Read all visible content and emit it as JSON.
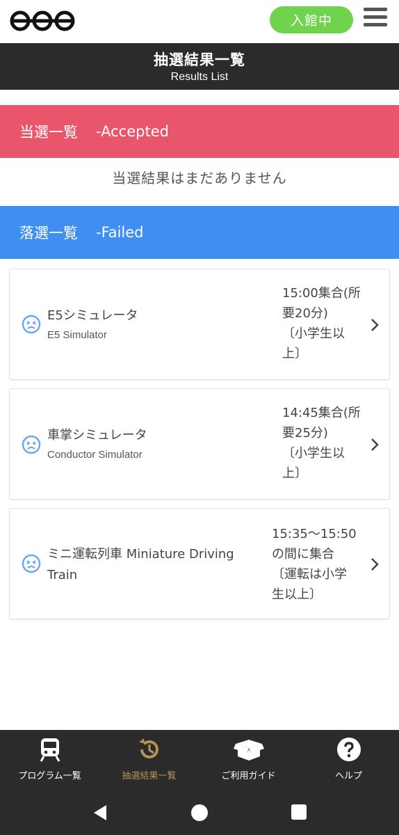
{
  "header": {
    "status_label": "入館中",
    "logo_icon": "three-circles-logo",
    "menu_icon": "hamburger-menu-icon"
  },
  "title": {
    "ja": "抽選結果一覧",
    "en": "Results List"
  },
  "accepted": {
    "label_ja": "当選一覧",
    "label_en": "-Accepted",
    "empty_message": "当選結果はまだありません",
    "color": "#e9566c"
  },
  "failed": {
    "label_ja": "落選一覧",
    "label_en": "-Failed",
    "color": "#3e8ff0",
    "items": [
      {
        "name": "E5シミュレータ",
        "name_en": "E5 Simulator",
        "time": "15:00集合(所\n要20分)\n〔小学生以\n上〕"
      },
      {
        "name": "車掌シミュレータ",
        "name_en": "Conductor Simulator",
        "time": "14:45集合(所\n要25分)\n〔小学生以\n上〕"
      },
      {
        "name": "ミニ運転列車 Miniature Driving\nTrain",
        "name_en": "",
        "time": "15:35〜15:50\nの間に集合\n〔運転は小学\n生以上〕"
      }
    ]
  },
  "bottom_nav": {
    "items": [
      {
        "label": "プログラム一覧",
        "icon": "train-icon"
      },
      {
        "label": "抽選結果一覧",
        "icon": "history-icon",
        "active": true
      },
      {
        "label": "ご利用ガイド",
        "icon": "open-box-icon"
      },
      {
        "label": "ヘルプ",
        "icon": "question-circle-icon"
      }
    ],
    "active_color": "#b39359"
  },
  "status_color": "#6fd34d"
}
